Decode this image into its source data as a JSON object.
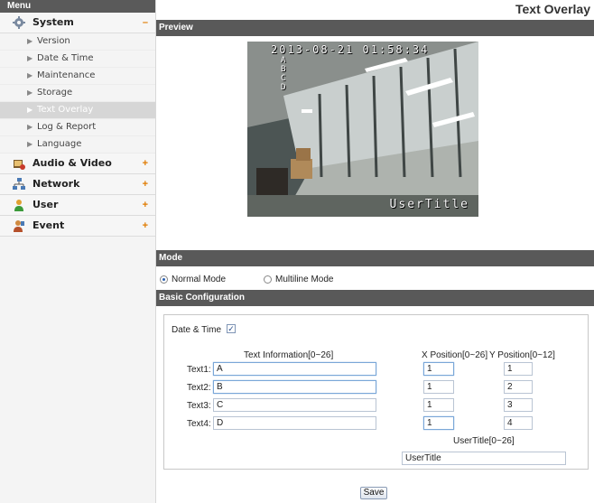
{
  "sidebar": {
    "header": "Menu",
    "categories": [
      {
        "label": "System",
        "toggle": "–",
        "icon": "gear-icon"
      },
      {
        "label": "Audio & Video",
        "toggle": "+",
        "icon": "camera-icon"
      },
      {
        "label": "Network",
        "toggle": "+",
        "icon": "network-icon"
      },
      {
        "label": "User",
        "toggle": "+",
        "icon": "user-icon"
      },
      {
        "label": "Event",
        "toggle": "+",
        "icon": "event-icon"
      }
    ],
    "system_items": [
      "Version",
      "Date & Time",
      "Maintenance",
      "Storage",
      "Text Overlay",
      "Log & Report",
      "Language"
    ],
    "active_item": "Text Overlay"
  },
  "main": {
    "title": "Text Overlay",
    "preview_section": "Preview",
    "preview": {
      "timestamp": "2013-08-21 01:58:34",
      "vertical_text": "A\nB\nC\nD",
      "user_title_overlay": "UserTitle"
    },
    "mode_section": "Mode",
    "mode_options": [
      "Normal Mode",
      "Multiline Mode"
    ],
    "mode_selected": "Normal Mode",
    "config_section": "Basic Configuration",
    "date_time_label": "Date & Time",
    "date_time_checked": true,
    "col_text_info": "Text Information[0~26]",
    "col_x": "X Position[0~26]",
    "col_y": "Y Position[0~12]",
    "rows": [
      {
        "label": "Text1:",
        "text": "A",
        "x": "1",
        "y": "1"
      },
      {
        "label": "Text2:",
        "text": "B",
        "x": "1",
        "y": "2"
      },
      {
        "label": "Text3:",
        "text": "C",
        "x": "1",
        "y": "3"
      },
      {
        "label": "Text4:",
        "text": "D",
        "x": "1",
        "y": "4"
      }
    ],
    "user_title_label": "UserTitle[0~26]",
    "user_title_value": "UserTitle",
    "save_label": "Save"
  }
}
